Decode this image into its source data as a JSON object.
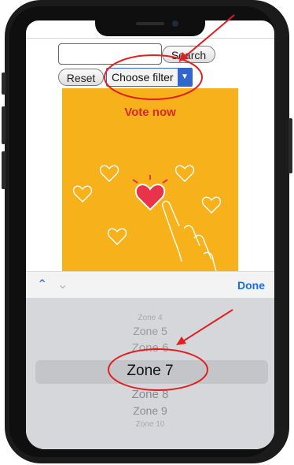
{
  "toolbar": {
    "search_label": "Search",
    "reset_label": "Reset",
    "filter_label": "Choose filter",
    "done_label": "Done"
  },
  "poster": {
    "title": "Vote now"
  },
  "picker": {
    "selected": "Zone 7",
    "items": [
      "Zone 4",
      "Zone 5",
      "Zone 6",
      "Zone 7",
      "Zone 8",
      "Zone 9",
      "Zone 10"
    ]
  },
  "colors": {
    "poster_bg": "#f7b21b",
    "accent_red": "#d9272e",
    "ios_blue": "#1d6fd8",
    "annotation_red": "#e02020"
  },
  "icons": {
    "prev": "chevron-up-icon",
    "next": "chevron-down-icon",
    "select_arrow": "triangle-down-icon"
  }
}
